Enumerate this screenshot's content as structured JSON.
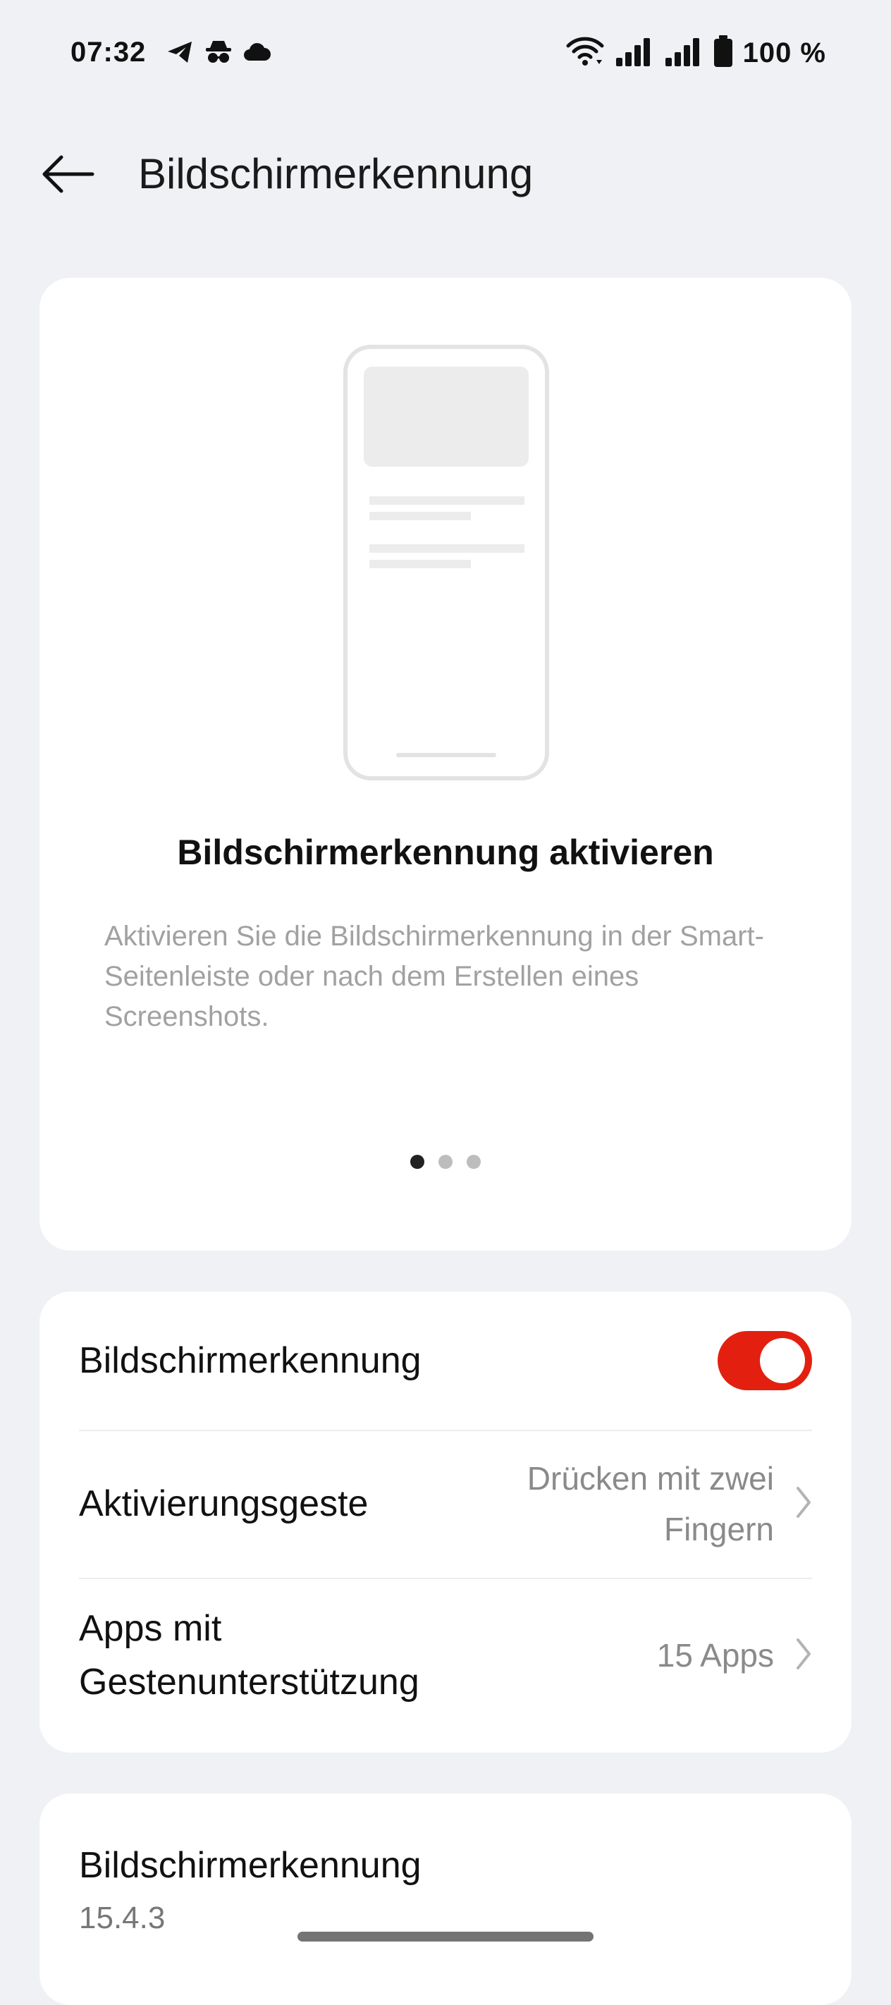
{
  "status_bar": {
    "time": "07:32",
    "left_icons": [
      "telegram-icon",
      "incognito-icon",
      "cloud-icon"
    ],
    "right_icons": [
      "wifi-icon",
      "signal-icon",
      "signal-icon",
      "battery-icon"
    ],
    "battery_text": "100 %"
  },
  "app_bar": {
    "back_icon": "arrow-left-icon",
    "title": "Bildschirmerkennung"
  },
  "intro": {
    "heading": "Bildschirmerkennung aktivieren",
    "description": "Aktivieren Sie die Bildschirmerkennung in der Smart-Seitenleiste oder nach dem Erstellen eines Screenshots.",
    "pager": {
      "count": 3,
      "active_index": 0
    }
  },
  "settings": {
    "toggle_row": {
      "label": "Bildschirmerkennung",
      "enabled": true
    },
    "gesture_row": {
      "label": "Aktivierungsgeste",
      "value_line1": "Drücken mit zwei",
      "value_line2": "Fingern"
    },
    "apps_row": {
      "label_line1": "Apps mit",
      "label_line2": "Gestenunterstützung",
      "value": "15 Apps"
    }
  },
  "version": {
    "title": "Bildschirmerkennung",
    "number": "15.4.3"
  },
  "colors": {
    "accent": "#e3200f",
    "background": "#f0f1f4",
    "card": "#ffffff"
  }
}
